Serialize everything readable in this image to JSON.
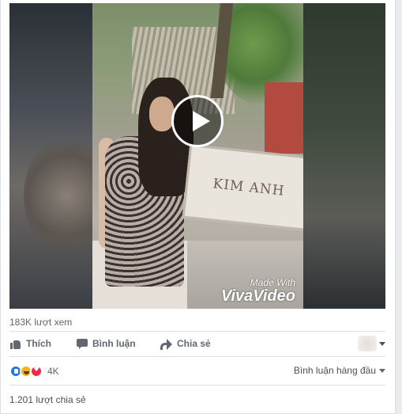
{
  "video": {
    "sign_text": "KIM ANH",
    "watermark_line1": "Made With",
    "watermark_line2": "VivaVideo"
  },
  "stats": {
    "views": "183K lượt xem"
  },
  "actions": {
    "like_label": "Thích",
    "comment_label": "Bình luận",
    "share_label": "Chia sẻ"
  },
  "reactions": {
    "icons": [
      "like-icon",
      "haha-icon",
      "love-icon"
    ],
    "count": "4K",
    "colors": {
      "like": "#1877f2",
      "haha": "#f7b125",
      "love": "#f0284a"
    }
  },
  "comments": {
    "sort_label": "Bình luận hàng đầu"
  },
  "shares": {
    "count_label": "1.201 lượt chia sẻ"
  }
}
